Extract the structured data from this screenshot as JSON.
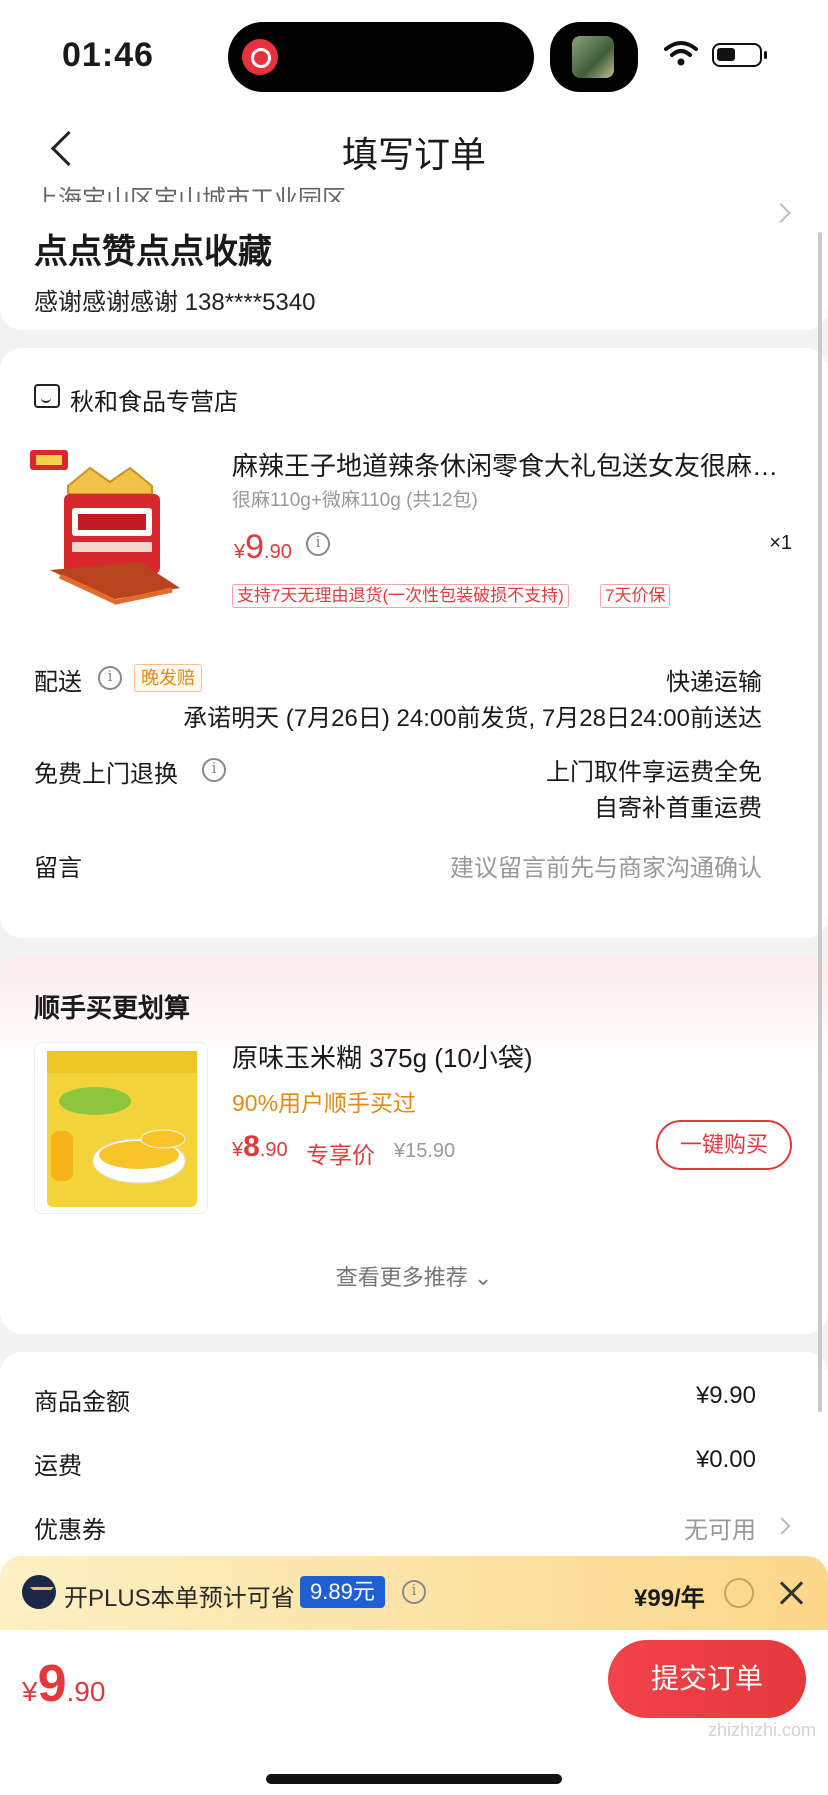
{
  "status_bar": {
    "time": "01:46"
  },
  "nav": {
    "title": "填写订单"
  },
  "address": {
    "region": "上海宝山区宝山城市工业园区",
    "detail": "点点赞点点收藏",
    "contact": "感谢感谢感谢  138****5340"
  },
  "order": {
    "store_name": "秋和食品专营店",
    "product": {
      "name": "麻辣王子地道辣条休闲零食大礼包送女友很麻很...",
      "spec": "很麻110g+微麻110g (共12包)",
      "price_symbol": "¥",
      "price_int": "9",
      "price_dec": ".90",
      "qty": "×1",
      "tags": [
        "支持7天无理由退货(一次性包装破损不支持)",
        "7天价保"
      ]
    },
    "delivery": {
      "label": "配送",
      "late_tag": "晚发赔",
      "method": "快递运输",
      "promise": "承诺明天 (7月26日) 24:00前发货, 7月28日24:00前送达"
    },
    "return": {
      "label": "免费上门退换",
      "line1": "上门取件享运费全免",
      "line2": "自寄补首重运费"
    },
    "message": {
      "label": "留言",
      "placeholder": "建议留言前先与商家沟通确认"
    }
  },
  "recommend": {
    "title": "顺手买更划算",
    "item": {
      "name": "原味玉米糊 375g (10小袋)",
      "buyers": "90%用户顺手买过",
      "price_symbol": "¥",
      "price_int": "8",
      "price_dec": ".90",
      "special_label": "专享价",
      "original_price": "¥15.90",
      "buy_label": "一键购买"
    },
    "more_label": "查看更多推荐 ⌄"
  },
  "summary": {
    "rows": [
      {
        "label": "商品金额",
        "value": "¥9.90"
      },
      {
        "label": "运费",
        "value": "¥0.00"
      },
      {
        "label": "优惠券",
        "value": "无可用"
      }
    ]
  },
  "plus": {
    "text": "开PLUS本单预计可省",
    "amount": "9.89元",
    "fee": "¥99/年"
  },
  "bottom": {
    "total_symbol": "¥",
    "total_int": "9",
    "total_dec": ".90",
    "submit_label": "提交订单",
    "watermark": "zhizhizhi.com"
  },
  "colors": {
    "accent": "#e4393c",
    "orange": "#e38a14",
    "plus_blue": "#1f5fd4"
  }
}
